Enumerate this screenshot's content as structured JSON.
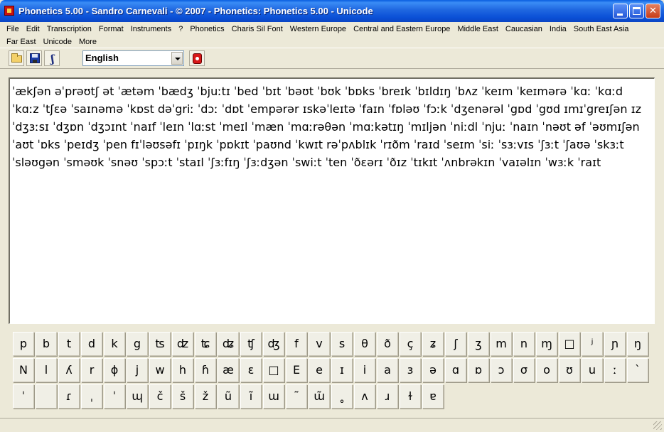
{
  "window": {
    "title": "Phonetics 5.00 - Sandro Carnevali - ©  2007 - Phonetics: Phonetics 5.00 - Unicode"
  },
  "menu": {
    "row1": [
      "File",
      "Edit",
      "Transcription",
      "Format",
      "Instruments",
      "?",
      "Phonetics",
      "Charis Sil Font",
      "Western Europe",
      "Central and Eastern Europe",
      "Middle East",
      "Caucasian",
      "India",
      "South East Asia"
    ],
    "row2": [
      "Far East",
      "Unicode",
      "More"
    ]
  },
  "toolbar": {
    "icons": [
      "open-folder-icon",
      "save-disk-icon",
      "font-icon",
      "record-icon"
    ],
    "language_value": "English"
  },
  "editor": {
    "text": "ˈækʃən əˈprəʊtʃ ət ˈætəm ˈbædʒ ˈbjuːtɪ ˈbed ˈbɪt ˈbəʊt ˈbʊk ˈbɒks ˈbreɪk ˈbɪldɪŋ ˈbʌz ˈkeɪm ˈkeɪmərə ˈkɑː ˈkɑːd ˈkɑːz ˈtʃɛə ˈsaɪnəmə ˈkɒst dəˈgriː ˈdɔː ˈdɒt ˈempərər ɪskəˈleɪtə ˈfaɪn ˈfɒləʊ ˈfɔːk ˈdʒenərəl ˈgɒd ˈgʊd ɪmɪˈgreɪʃən ɪz ˈdʒɜːsɪ ˈdʒɒn ˈdʒɔɪnt ˈnaɪf ˈleɪn ˈlɑːst ˈmeɪl ˈmæn ˈmɑːrəθən ˈmɑːkətɪŋ ˈmɪljən ˈniːdl ˈnjuː ˈnaɪn ˈnəʊt əf ˈəʊmɪʃən ˈaʊt ˈɒks ˈpeɪdʒ ˈpen fɪˈləʊsəfɪ ˈpɪŋk ˈpɒkɪt ˈpaʊnd ˈkwɪt rəˈpʌblɪk ˈrɪðm ˈraɪd ˈseɪm ˈsiː ˈsɜːvɪs ˈʃɜːt ˈʃaʊə ˈskɜːt ˈsləʊgən ˈsməʊk ˈsnəʊ ˈspɔːt ˈstaɪl ˈʃɜːfɪŋ ˈʃɜːdʒən ˈswiːt ˈten ˈðɛərɪ ˈðɪz ˈtɪkɪt ˈʌnbrəkɪn ˈvaɪəlɪn ˈwɜːk ˈraɪt"
  },
  "keyboard": {
    "row1": [
      "p",
      "b",
      "t",
      "d",
      "k",
      "g",
      "ʦ",
      "ʣ",
      "ʨ",
      "ʥ",
      "ʧ",
      "ʤ",
      "f",
      "v",
      "s",
      "θ",
      "ð",
      "ç",
      "ʑ",
      "ʃ",
      "ʒ",
      "m",
      "n",
      "ɱ",
      "□",
      "ʲ",
      "ɲ",
      "ŋ"
    ],
    "row2": [
      "N",
      "l",
      "ʎ",
      "r",
      "ɸ",
      "j",
      "w",
      "h",
      "ɦ",
      "æ",
      "ε",
      "□",
      "E",
      "e",
      "ɪ",
      "i",
      "a",
      "ɜ",
      "ə",
      "ɑ",
      "ɒ",
      "ɔ",
      "σ",
      "o",
      "ʊ",
      "u",
      "ː",
      "ˋ"
    ],
    "row3": [
      "ˈ",
      "",
      "ɾ",
      "ˌ",
      "ˈ",
      "ɰ",
      "č",
      "š",
      "ž",
      "ũ",
      "ĩ",
      "ɯ",
      "˜",
      "ɯ̃",
      "˳",
      "ʌ",
      "ɹ",
      "ɫ",
      "ɐ"
    ]
  },
  "colors": {
    "titlebar": "#0a4fd6",
    "window_bg": "#ece9d8",
    "editor_bg": "#ffffff",
    "close_button": "#c83c18"
  }
}
